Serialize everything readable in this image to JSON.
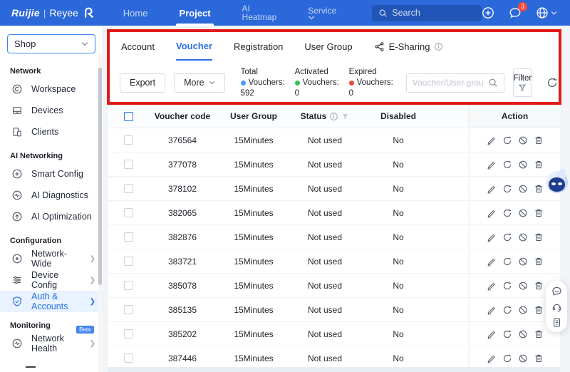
{
  "colors": {
    "navbar": "#2b68d9",
    "accent": "#2970e5",
    "annotation": "#e01a1a",
    "notification_badge": "#f5483b"
  },
  "navbar": {
    "brand": {
      "primary": "Ruijie",
      "divider": "|",
      "secondary": "Reyee"
    },
    "menu": [
      {
        "label": "Home"
      },
      {
        "label": "Project"
      },
      {
        "label_line1": "AI",
        "label_line2": "Heatmap"
      },
      {
        "label": "Service"
      }
    ],
    "search_placeholder": "Search",
    "notification_count": "3"
  },
  "sidebar": {
    "org_selector_value": "Shop",
    "sections": [
      {
        "label": "Network",
        "items": [
          {
            "label": "Workspace"
          },
          {
            "label": "Devices"
          },
          {
            "label": "Clients"
          }
        ]
      },
      {
        "label": "AI Networking",
        "items": [
          {
            "label": "Smart Config"
          },
          {
            "label": "AI Diagnostics"
          },
          {
            "label": "AI Optimization"
          }
        ]
      },
      {
        "label": "Configuration",
        "items": [
          {
            "label": "Network-Wide"
          },
          {
            "label": "Device Config"
          },
          {
            "label": "Auth & Accounts"
          }
        ]
      },
      {
        "label": "Monitoring",
        "items": [
          {
            "label": "Network Health",
            "badge": "Beta"
          }
        ]
      }
    ]
  },
  "tabs": [
    {
      "label": "Account"
    },
    {
      "label": "Voucher"
    },
    {
      "label": "Registration"
    },
    {
      "label": "User Group"
    },
    {
      "label": "E-Sharing"
    }
  ],
  "toolbar": {
    "export_label": "Export",
    "more_label": "More",
    "stats": [
      {
        "title": "Total",
        "label": "Vouchers:",
        "value": "592",
        "color": "#4b9bf5"
      },
      {
        "title": "Activated",
        "label": "Vouchers:",
        "value": "0",
        "color": "#2fc25b"
      },
      {
        "title": "Expired",
        "label": "Vouchers:",
        "value": "0",
        "color": "#f2433d"
      }
    ],
    "search_placeholder": "Voucher/User group",
    "filter_label": "Filter"
  },
  "table": {
    "headers": {
      "code": "Voucher code",
      "group": "User Group",
      "status": "Status",
      "disabled": "Disabled",
      "action": "Action"
    },
    "rows": [
      {
        "code": "376564",
        "group": "15Minutes",
        "status": "Not used",
        "disabled": "No"
      },
      {
        "code": "377078",
        "group": "15Minutes",
        "status": "Not used",
        "disabled": "No"
      },
      {
        "code": "378102",
        "group": "15Minutes",
        "status": "Not used",
        "disabled": "No"
      },
      {
        "code": "382065",
        "group": "15Minutes",
        "status": "Not used",
        "disabled": "No"
      },
      {
        "code": "382876",
        "group": "15Minutes",
        "status": "Not used",
        "disabled": "No"
      },
      {
        "code": "383721",
        "group": "15Minutes",
        "status": "Not used",
        "disabled": "No"
      },
      {
        "code": "385078",
        "group": "15Minutes",
        "status": "Not used",
        "disabled": "No"
      },
      {
        "code": "385135",
        "group": "15Minutes",
        "status": "Not used",
        "disabled": "No"
      },
      {
        "code": "385202",
        "group": "15Minutes",
        "status": "Not used",
        "disabled": "No"
      },
      {
        "code": "387446",
        "group": "15Minutes",
        "status": "Not used",
        "disabled": "No"
      }
    ]
  }
}
